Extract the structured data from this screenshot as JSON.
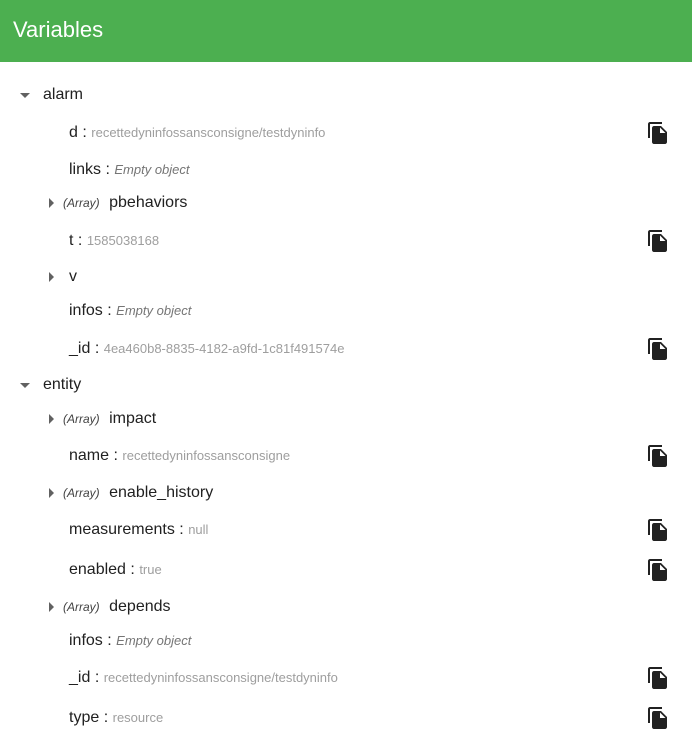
{
  "header": {
    "title": "Variables"
  },
  "tree": {
    "alarm": {
      "label": "alarm",
      "d": {
        "key": "d",
        "sep": ":",
        "value": "recettedyninfossansconsigne/testdyninfo"
      },
      "links": {
        "key": "links",
        "sep": ":",
        "value": "Empty object"
      },
      "pbehaviors": {
        "tag": "(Array)",
        "key": "pbehaviors"
      },
      "t": {
        "key": "t",
        "sep": ":",
        "value": "1585038168"
      },
      "v": {
        "key": "v"
      },
      "infos": {
        "key": "infos",
        "sep": ":",
        "value": "Empty object"
      },
      "id": {
        "key": "_id",
        "sep": ":",
        "value": "4ea460b8-8835-4182-a9fd-1c81f491574e"
      }
    },
    "entity": {
      "label": "entity",
      "impact": {
        "tag": "(Array)",
        "key": "impact"
      },
      "name": {
        "key": "name",
        "sep": ":",
        "value": "recettedyninfossansconsigne"
      },
      "enable_history": {
        "tag": "(Array)",
        "key": "enable_history"
      },
      "measurements": {
        "key": "measurements",
        "sep": ":",
        "value": "null"
      },
      "enabled": {
        "key": "enabled",
        "sep": ":",
        "value": "true"
      },
      "depends": {
        "tag": "(Array)",
        "key": "depends"
      },
      "infos": {
        "key": "infos",
        "sep": ":",
        "value": "Empty object"
      },
      "id": {
        "key": "_id",
        "sep": ":",
        "value": "recettedyninfossansconsigne/testdyninfo"
      },
      "type": {
        "key": "type",
        "sep": ":",
        "value": "resource"
      }
    }
  },
  "icons": {
    "expanded": "caret-down-icon",
    "collapsed": "caret-right-icon",
    "copy": "copy-file-icon"
  },
  "colors": {
    "header": "#4caf50",
    "header_text": "#ffffff",
    "key_text": "#212121",
    "value_text": "#9e9e9e",
    "icon": "#212121"
  }
}
